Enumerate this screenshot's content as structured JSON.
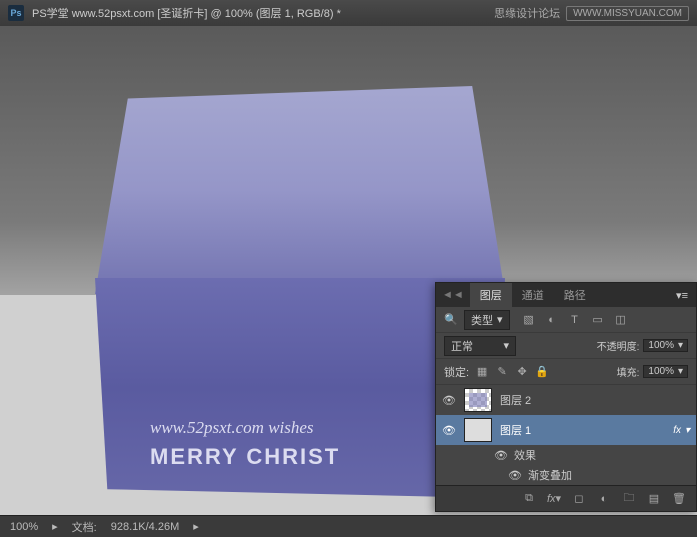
{
  "titlebar": {
    "app": "Ps",
    "title": "PS学堂  www.52psxt.com [圣诞折卡] @ 100% (图层 1, RGB/8) *"
  },
  "watermark": {
    "text": "思缘设计论坛",
    "url": "WWW.MISSYUAN.COM"
  },
  "card": {
    "line1": "www.52psxt.com   wishes",
    "line2": "MERRY CHRIST"
  },
  "statusbar": {
    "zoom": "100%",
    "doc_label": "文档:",
    "doc_size": "928.1K/4.26M"
  },
  "panel": {
    "tabs": {
      "layers": "图层",
      "channels": "通道",
      "paths": "路径"
    },
    "filter_label": "类型",
    "blend_mode": "正常",
    "opacity_label": "不透明度:",
    "opacity_value": "100%",
    "lock_label": "锁定:",
    "fill_label": "填充:",
    "fill_value": "100%",
    "layers": [
      {
        "name": "图层 2"
      },
      {
        "name": "图层 1",
        "fx": "fx"
      }
    ],
    "effects": {
      "label": "效果",
      "gradient": "渐变叠加"
    }
  }
}
